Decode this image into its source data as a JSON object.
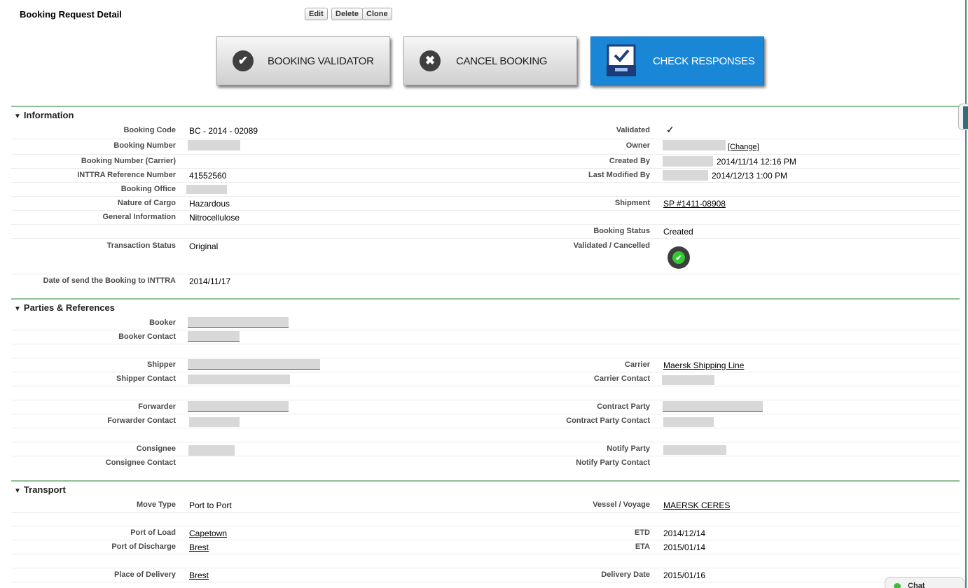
{
  "page": {
    "title": "Booking Request Detail"
  },
  "top_buttons": {
    "edit": "Edit",
    "delete": "Delete",
    "clone": "Clone"
  },
  "actions": {
    "validator": "BOOKING VALIDATOR",
    "cancel": "CANCEL BOOKING",
    "check": "CHECK RESPONSES"
  },
  "icons": {
    "validator": "checkmark-circle-icon",
    "cancel": "x-circle-icon",
    "check": "inbox-tray-check-icon",
    "validated_status": "green-check-circle-icon"
  },
  "colors": {
    "accent_blue": "#1a86d6",
    "section_line": "#8fbf95",
    "status_green": "#2ecc2e"
  },
  "sections": {
    "information": "Information",
    "parties": "Parties & References",
    "transport": "Transport"
  },
  "info": {
    "booking_code_label": "Booking Code",
    "booking_code": "BC - 2014 - 02089",
    "booking_number_label": "Booking Number",
    "booking_number_carrier_label": "Booking Number (Carrier)",
    "inttra_ref_label": "INTTRA Reference Number",
    "inttra_ref": "41552560",
    "booking_office_label": "Booking Office",
    "nature_label": "Nature of Cargo",
    "nature": "Hazardous",
    "general_label": "General Information",
    "general": "Nitrocellulose",
    "transaction_label": "Transaction Status",
    "transaction": "Original",
    "date_send_label": "Date of send the Booking to INTTRA",
    "date_send": "2014/11/17",
    "validated_label": "Validated",
    "validated_mark": "✓",
    "owner_label": "Owner",
    "owner_change": "[Change]",
    "created_by_label": "Created By",
    "created_by_date": "2014/11/14 12:16 PM",
    "modified_by_label": "Last Modified By",
    "modified_by_date": "2014/12/13 1:00 PM",
    "shipment_label": "Shipment",
    "shipment": "SP #1411-08908",
    "booking_status_label": "Booking Status",
    "booking_status": "Created",
    "validated_cancelled_label": "Validated / Cancelled"
  },
  "parties": {
    "booker_label": "Booker",
    "booker_contact_label": "Booker Contact",
    "shipper_label": "Shipper",
    "shipper_contact_label": "Shipper Contact",
    "forwarder_label": "Forwarder",
    "forwarder_contact_label": "Forwarder Contact",
    "consignee_label": "Consignee",
    "consignee_contact_label": "Consignee Contact",
    "carrier_label": "Carrier",
    "carrier": "Maersk Shipping Line",
    "carrier_contact_label": "Carrier Contact",
    "contract_party_label": "Contract Party",
    "contract_party_contact_label": "Contract Party Contact",
    "notify_party_label": "Notify Party",
    "notify_party_contact_label": "Notify Party Contact"
  },
  "transport": {
    "move_type_label": "Move Type",
    "move_type": "Port to Port",
    "vessel_label": "Vessel / Voyage",
    "vessel": "MAERSK CERES",
    "pol_label": "Port of Load",
    "pol": "Capetown",
    "pod_label": "Port of Discharge",
    "pod": "Brest",
    "etd_label": "ETD",
    "etd": "2014/12/14",
    "eta_label": "ETA",
    "eta": "2015/01/14",
    "place_delivery_label": "Place of Delivery",
    "place_delivery": "Brest",
    "delivery_date_label": "Delivery Date",
    "delivery_date": "2015/01/16"
  },
  "chat": {
    "label": "Chat"
  }
}
